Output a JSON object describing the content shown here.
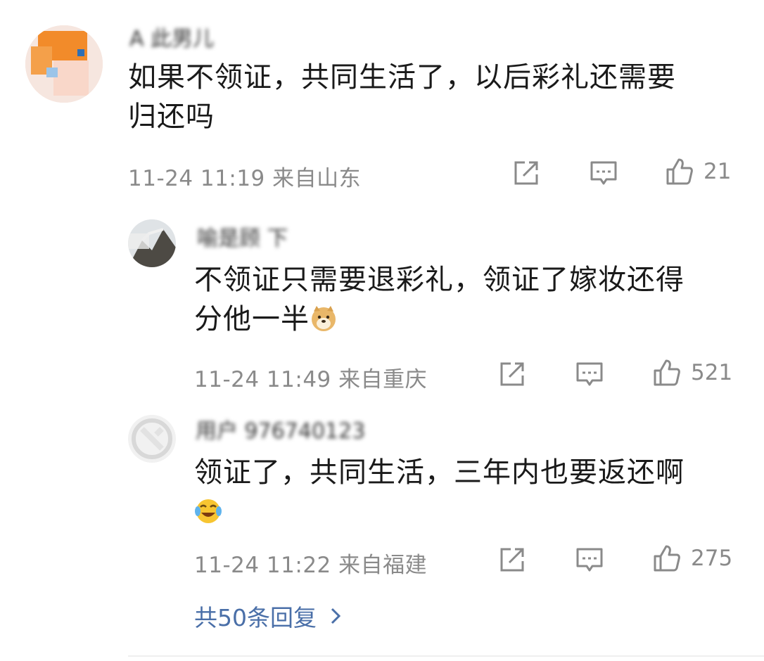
{
  "comments": [
    {
      "user": "A 此男儿",
      "text_line1": "如果不领证，共同生活了，以后彩礼还需要",
      "text_line2": "归还吗",
      "meta": "11-24 11:19 来自山东",
      "likes": "21"
    },
    {
      "user": "喻是顾 下",
      "text_line1": "不领证只需要退彩礼，领证了嫁妆还得",
      "text_line2": "分他一半",
      "emoji": "doge-emoji-icon",
      "meta": "11-24 11:49 来自重庆",
      "likes": "521"
    },
    {
      "user": "用户 976740123",
      "text_line1": "领证了，共同生活，三年内也要返还啊",
      "emoji": "laugh-cry-emoji-icon",
      "meta": "11-24 11:22 来自福建",
      "likes": "275"
    }
  ],
  "replies_link": "共50条回复",
  "colors": {
    "meta": "#8a8a8a",
    "link": "#4a6fa8",
    "text": "#1a1a1a"
  }
}
